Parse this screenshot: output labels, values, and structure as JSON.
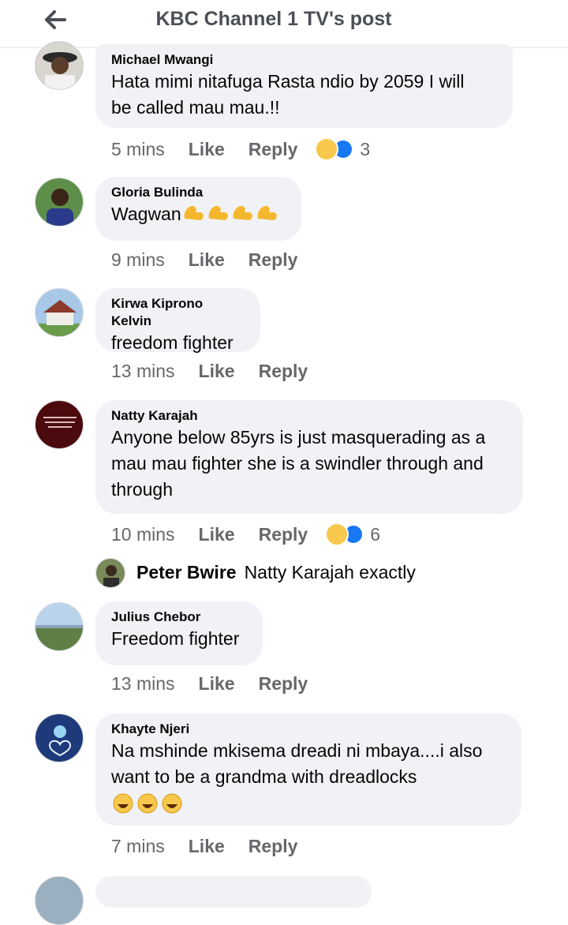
{
  "header": {
    "title": "KBC Channel 1 TV's post",
    "back_icon": "arrow-left-icon"
  },
  "actions": {
    "like": "Like",
    "reply": "Reply"
  },
  "colors": {
    "bubble": "#f0f2f5",
    "meta": "#65676b",
    "like_blue": "#1877f2",
    "laugh_yellow": "#f7c84b"
  },
  "comments": [
    {
      "name": "Michael Mwangi",
      "text_lines": [
        "Hata mimi nitafuga  Rasta ndio by  2059 I will",
        "be called mau mau.!!"
      ],
      "time": "5 mins",
      "reactions": [
        "laugh",
        "like"
      ],
      "reaction_count": "3"
    },
    {
      "name": "Gloria Bulinda",
      "text": "Wagwan",
      "text_emoji": "flexed-biceps x4",
      "time": "9 mins"
    },
    {
      "name": "Kirwa Kiprono Kelvin",
      "text": "freedom fighter",
      "time": "13 mins"
    },
    {
      "name": "Natty Karajah",
      "text_lines": [
        "Anyone below 85yrs is just masquerading as a",
        "mau mau fighter she is a swindler through and",
        "through"
      ],
      "time": "10 mins",
      "reactions": [
        "laugh",
        "like"
      ],
      "reaction_count": "6"
    },
    {
      "name": "Julius Chebor",
      "text": "Freedom fighter",
      "time": "13 mins"
    },
    {
      "name": "Khayte Njeri",
      "text_lines": [
        "Na mshinde mkisema dreadi ni mbaya....i also",
        "want to be a grandma with dreadlocks"
      ],
      "text_emoji": "rolling-laughing x3",
      "time": "7 mins"
    }
  ],
  "reply_preview": {
    "name": "Peter Bwire",
    "text": "Natty Karajah exactly"
  }
}
